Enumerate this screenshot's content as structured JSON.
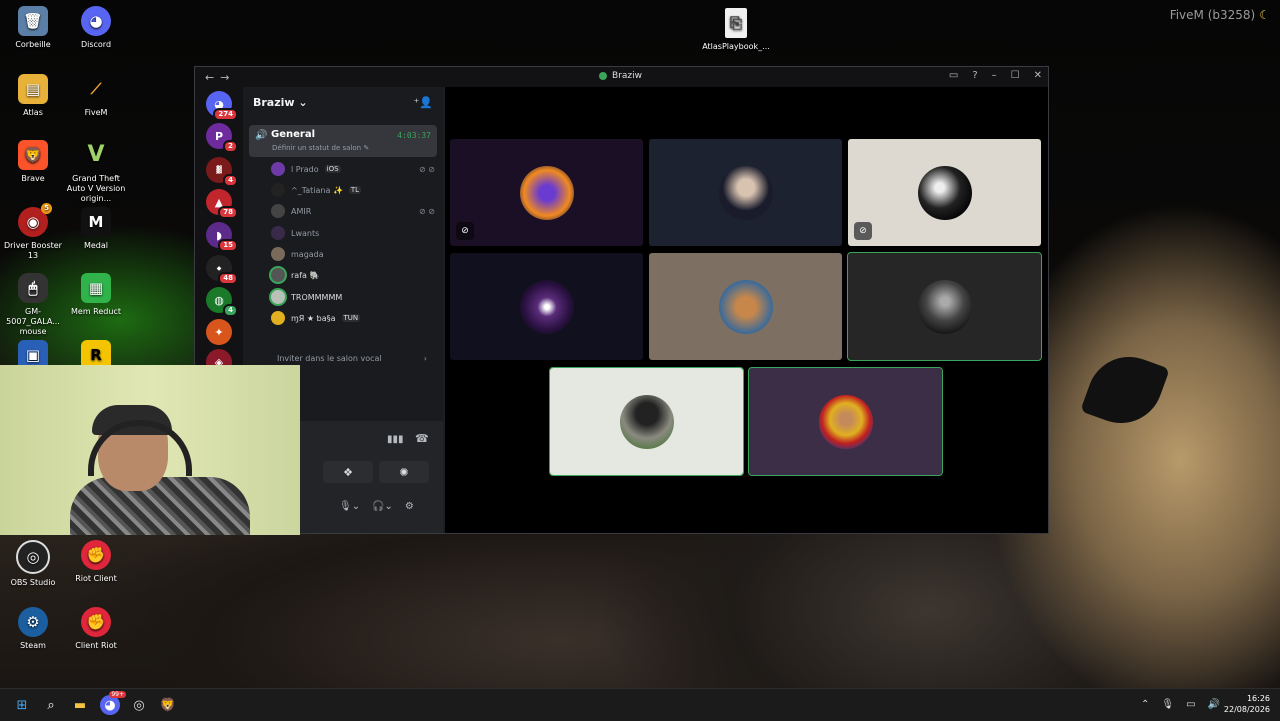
{
  "desktop": {
    "watermark": "FiveM (b3258)",
    "icons": [
      {
        "label": "Corbeille",
        "icon": "recycle-bin-icon"
      },
      {
        "label": "Discord",
        "icon": "discord-icon"
      },
      {
        "label": "Atlas",
        "icon": "folder-icon"
      },
      {
        "label": "FiveM",
        "icon": "fivem-icon"
      },
      {
        "label": "Brave",
        "icon": "brave-icon"
      },
      {
        "label": "Grand Theft Auto V Version origin...",
        "icon": "gta-icon"
      },
      {
        "label": "Driver Booster 13",
        "icon": "driver-booster-icon",
        "badge": "5"
      },
      {
        "label": "Medal",
        "icon": "medal-icon"
      },
      {
        "label": "GM-5007_GALA... mouse",
        "icon": "mouse-icon"
      },
      {
        "label": "Mem Reduct",
        "icon": "mem-reduct-icon"
      },
      {
        "label": "OBS Studio",
        "icon": "obs-icon"
      },
      {
        "label": "Riot Client",
        "icon": "riot-icon"
      },
      {
        "label": "Steam",
        "icon": "steam-icon"
      },
      {
        "label": "Client Riot",
        "icon": "riot-icon"
      },
      {
        "label": "AtlasPlaybook_...",
        "icon": "file-icon"
      }
    ]
  },
  "discord": {
    "window_title": "Braziw",
    "server_name": "Braziw",
    "guild_badges": [
      "274",
      "2",
      "4",
      "78",
      "15",
      "48",
      "4"
    ],
    "voice_channel": {
      "name": "General",
      "timer": "4:03:37",
      "status_placeholder": "Définir un statut de salon"
    },
    "members": [
      {
        "name": "l Prado",
        "tag": "iOS",
        "muted": true
      },
      {
        "name": "^_Tatiana ✨",
        "tag": "TL",
        "muted": false
      },
      {
        "name": "AMIR",
        "tag": "",
        "muted": true
      },
      {
        "name": "Lwants",
        "tag": "",
        "muted": false
      },
      {
        "name": "magada",
        "tag": "",
        "muted": false
      },
      {
        "name": "rafa 🐘",
        "tag": "",
        "muted": false
      },
      {
        "name": "TROMMMMM",
        "tag": "",
        "muted": false
      },
      {
        "name": "ɱЯ ★ ƅa§a",
        "tag": "TUN",
        "muted": false
      }
    ],
    "invite_label": "Inviter dans le salon vocal",
    "accent_color": "#3ba55c"
  },
  "taskbar": {
    "time": "16:26",
    "date": "22/08/2026",
    "discord_badge": "99+"
  }
}
